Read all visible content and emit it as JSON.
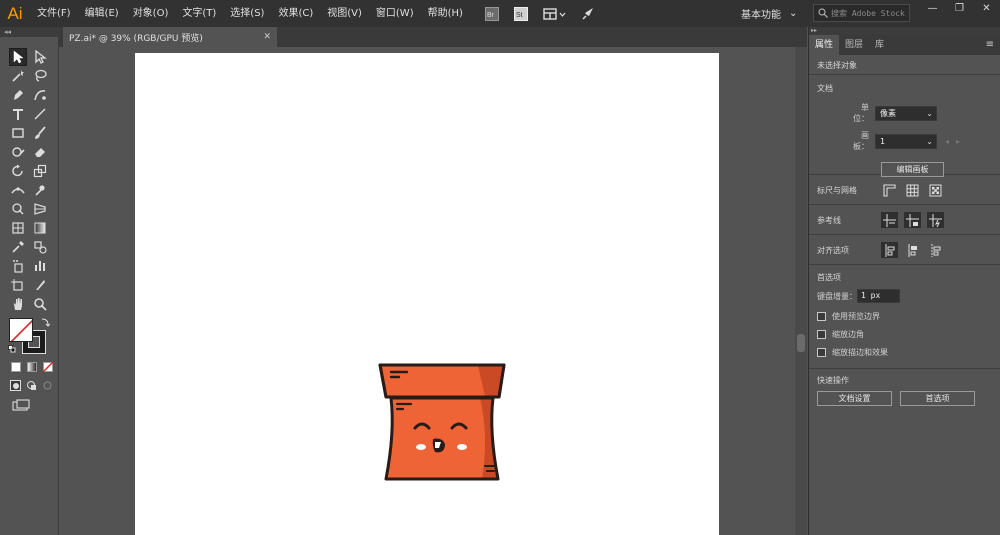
{
  "app": {
    "logo": "Ai"
  },
  "menu": [
    "文件(F)",
    "编辑(E)",
    "对象(O)",
    "文字(T)",
    "选择(S)",
    "效果(C)",
    "视图(V)",
    "窗口(W)",
    "帮助(H)"
  ],
  "menubar_icons": {
    "bridge": "Br",
    "stock": "St",
    "arrange": "arrange-documents-icon",
    "gpu": "gpu-performance-icon"
  },
  "workspace": {
    "label": "基本功能",
    "caret": "⌄"
  },
  "search": {
    "placeholder": "搜索 Adobe Stock"
  },
  "window_controls": {
    "minimize": "—",
    "maximize": "❐",
    "close": "✕"
  },
  "document_tab": {
    "title": "PZ.ai* @ 39% (RGB/GPU 预览)",
    "close": "✕"
  },
  "panel": {
    "tabs": [
      "属性",
      "图层",
      "库"
    ],
    "active_tab": "属性",
    "menu": "≡",
    "selection_status": "未选择对象",
    "document": {
      "title": "文档",
      "units_label": "单位：",
      "units_value": "像素",
      "artboard_label": "画板：",
      "artboard_value": "1",
      "edit_artboards_button": "编辑画板"
    },
    "rulers_grids": {
      "title": "标尺与网格"
    },
    "guides": {
      "title": "参考线"
    },
    "align": {
      "title": "对齐选项"
    },
    "preferences": {
      "title": "首选项",
      "keyboard_increment_label": "键盘增量：",
      "keyboard_increment_value": "1 px",
      "checkboxes": [
        "使用预览边界",
        "缩放边角",
        "缩放描边和效果"
      ]
    },
    "quick_actions": {
      "title": "快速操作",
      "document_setup_button": "文档设置",
      "preferences_button": "首选项"
    }
  },
  "colors": {
    "ui_dark": "#323232",
    "ui_mid": "#535353",
    "box_orange": "#ee6437",
    "box_shadow": "#c94a24",
    "outline": "#2b1b17",
    "brand": "#ff9a00"
  }
}
